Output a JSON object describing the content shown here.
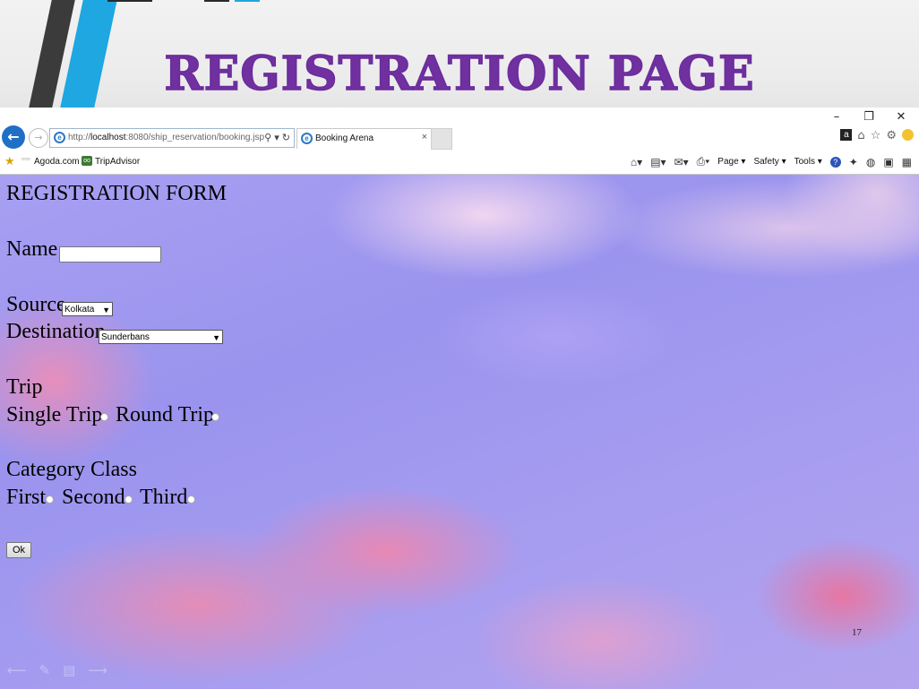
{
  "slide": {
    "title": "REGISTRATION PAGE",
    "page_number": "17",
    "title_color": "#7030a0"
  },
  "window_controls": {
    "minimize": "–",
    "restore": "❐",
    "close": "✕"
  },
  "browser": {
    "url_prefix": "http://",
    "url_host": "localhost",
    "url_rest": ":8080/ship_reservation/booking.jsp",
    "address_tools": "⚲ ▾ ↻",
    "tab_title": "Booking Arena",
    "tab_close": "×",
    "right_icons": [
      "amazon-icon",
      "home-icon",
      "favorites-star-icon",
      "settings-gear-icon",
      "smiley-icon"
    ],
    "amazon_glyph": "a",
    "home_glyph": "⌂",
    "star_glyph": "☆",
    "gear_glyph": "⚙"
  },
  "favorites": {
    "items": [
      "Agoda.com",
      "TripAdvisor"
    ]
  },
  "command_bar": {
    "page": "Page ▾",
    "safety": "Safety ▾",
    "tools": "Tools ▾",
    "help": "?"
  },
  "form": {
    "heading": "REGISTRATION FORM",
    "name_label": "Name",
    "name_value": "",
    "source_label": "Source",
    "source_value": "Kolkata",
    "destination_label": "Destination",
    "destination_value": "Sunderbans",
    "trip_label": "Trip",
    "trip_options": [
      "Single Trip",
      "Round Trip"
    ],
    "category_label": "Category Class",
    "category_options": [
      "First",
      "Second",
      "Third"
    ],
    "ok_label": "Ok"
  },
  "colors": {
    "accent_blue": "#1ea7e1",
    "back_button": "#1f6fc5"
  }
}
